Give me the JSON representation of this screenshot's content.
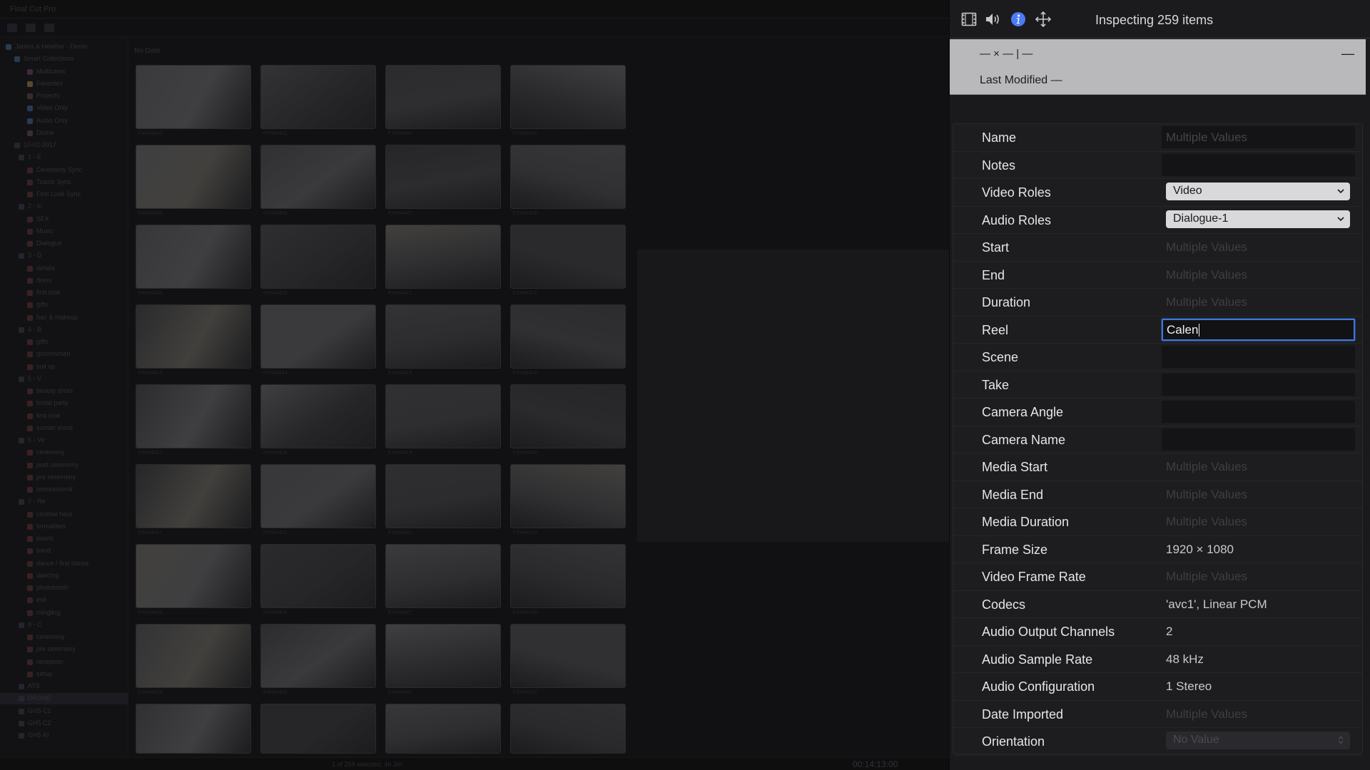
{
  "background_app": {
    "title": "Final Cut Pro",
    "browser_title": "No Date",
    "footer_status": "1 of 259 selected, 4h 3m",
    "footer_timecode": "00:14:13:00",
    "sidebar_items": [
      "James & Heather - Demo",
      "Smart Collections",
      "Multicams",
      "Favorites",
      "Projects",
      "Video Only",
      "Audio Only",
      "Drone",
      "10-02-2017",
      "1 - E",
      "Ceremony Sync",
      "Toasts Sync",
      "First Look Sync",
      "2 - Ic",
      "SFX",
      "Music",
      "Dialogue",
      "3 - D",
      "details",
      "dress",
      "first look",
      "gifts",
      "hair & makeup",
      "4 - B",
      "gifts",
      "groomsmen",
      "suit up",
      "5 - V",
      "beauty shots",
      "bridal party",
      "first look",
      "sunset shoot",
      "6 - Ve",
      "ceremony",
      "post ceremony",
      "pre ceremony",
      "processional",
      "7 - Re",
      "cocktail hour",
      "formalities",
      "toasts",
      "band",
      "dance / first dance",
      "dancing",
      "photobooth",
      "exit",
      "mingling",
      "8 - C",
      "ceremony",
      "pre ceremony",
      "reception",
      "setup",
      "ATS",
      "DRONE",
      "GH5 C1",
      "GH5 C2",
      "GH5 KI"
    ],
    "thumb_captions": [
      "FXH04401",
      "FXH04402",
      "FXH04403",
      "FXH04404",
      "FXH04405",
      "FXH04406",
      "FXH04407",
      "FXH04408",
      "FXH04409",
      "FXH04410",
      "FXH04411",
      "FXH04412",
      "FXH04413",
      "FXH04414",
      "FXH04415",
      "FXH04416",
      "FXH04417",
      "FXH04418",
      "FXH04419",
      "FXH04420",
      "FXH04421",
      "FXH04422",
      "FXH04423",
      "FXH04424",
      "FXH04425",
      "FXH04426",
      "FXH04427",
      "FXH04428",
      "FXH04429",
      "FXH04430",
      "FXH04431",
      "FXH04432"
    ]
  },
  "inspector": {
    "title": "Inspecting 259 items",
    "tab_icons": [
      "film-icon",
      "speaker-icon",
      "info-icon",
      "transform-icon"
    ],
    "active_tab": "info-icon",
    "header_name": "— × — | —",
    "header_collapse": "—",
    "header_modified": "Last Modified —",
    "placeholder_text": "Multiple Values",
    "properties": [
      {
        "label": "Name",
        "value": "Multiple Values",
        "kind": "input",
        "placeholder": true
      },
      {
        "label": "Notes",
        "value": "",
        "kind": "input"
      },
      {
        "label": "Video Roles",
        "value": "Video",
        "kind": "select"
      },
      {
        "label": "Audio Roles",
        "value": "Dialogue-1",
        "kind": "select"
      },
      {
        "label": "Start",
        "value": "Multiple Values",
        "kind": "readonly",
        "placeholder": true
      },
      {
        "label": "End",
        "value": "Multiple Values",
        "kind": "readonly",
        "placeholder": true
      },
      {
        "label": "Duration",
        "value": "Multiple Values",
        "kind": "readonly",
        "placeholder": true
      },
      {
        "label": "Reel",
        "value": "Calen",
        "kind": "input",
        "focused": true
      },
      {
        "label": "Scene",
        "value": "",
        "kind": "input"
      },
      {
        "label": "Take",
        "value": "",
        "kind": "input"
      },
      {
        "label": "Camera Angle",
        "value": "",
        "kind": "input"
      },
      {
        "label": "Camera Name",
        "value": "",
        "kind": "input"
      },
      {
        "label": "Media Start",
        "value": "Multiple Values",
        "kind": "readonly",
        "placeholder": true
      },
      {
        "label": "Media End",
        "value": "Multiple Values",
        "kind": "readonly",
        "placeholder": true
      },
      {
        "label": "Media Duration",
        "value": "Multiple Values",
        "kind": "readonly",
        "placeholder": true
      },
      {
        "label": "Frame Size",
        "value": "1920 × 1080",
        "kind": "readonly"
      },
      {
        "label": "Video Frame Rate",
        "value": "Multiple Values",
        "kind": "readonly",
        "placeholder": true
      },
      {
        "label": "Codecs",
        "value": "'avc1', Linear PCM",
        "kind": "readonly"
      },
      {
        "label": "Audio Output Channels",
        "value": "2",
        "kind": "readonly"
      },
      {
        "label": "Audio Sample Rate",
        "value": "48 kHz",
        "kind": "readonly"
      },
      {
        "label": "Audio Configuration",
        "value": "1 Stereo",
        "kind": "readonly"
      },
      {
        "label": "Date Imported",
        "value": "Multiple Values",
        "kind": "readonly",
        "placeholder": true
      },
      {
        "label": "Orientation",
        "value": "No Value",
        "kind": "select-disabled"
      }
    ]
  },
  "colors": {
    "accent_blue": "#3d78e0",
    "info_icon_blue": "#4b7bf5",
    "panel_bg": "#1a1a1c",
    "header_bg": "#b9b9bc"
  }
}
